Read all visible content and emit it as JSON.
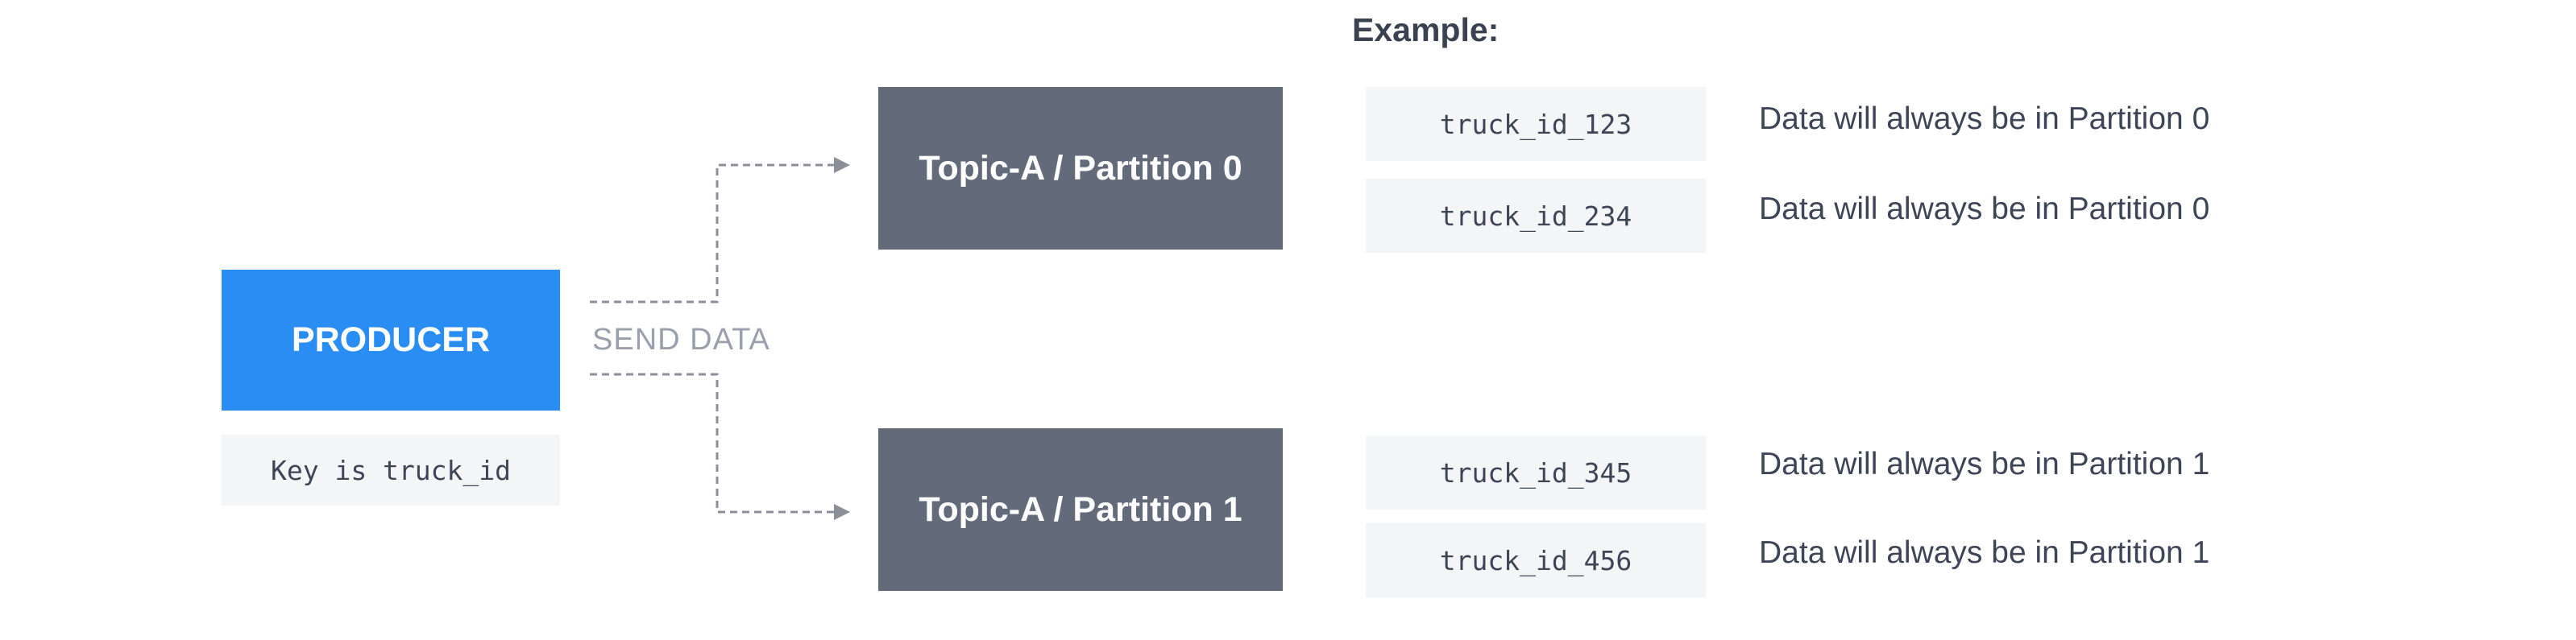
{
  "producer": {
    "label": "PRODUCER",
    "key_note": "Key is truck_id"
  },
  "send_label": "SEND DATA",
  "partitions": [
    {
      "label": "Topic-A / Partition 0"
    },
    {
      "label": "Topic-A / Partition 1"
    }
  ],
  "example": {
    "title": "Example:",
    "rows": [
      {
        "key": "truck_id_123",
        "description": "Data will always be in Partition 0"
      },
      {
        "key": "truck_id_234",
        "description": "Data will always be in Partition 0"
      },
      {
        "key": "truck_id_345",
        "description": "Data will always be in Partition 1"
      },
      {
        "key": "truck_id_456",
        "description": "Data will always be in Partition 1"
      }
    ]
  },
  "colors": {
    "producer": "#2a8df3",
    "partition": "#636b7b",
    "key_background": "#f4f5f6",
    "connector": "#8a8f99",
    "text_dark": "#3e4556",
    "text_muted": "#9aa0ab"
  }
}
